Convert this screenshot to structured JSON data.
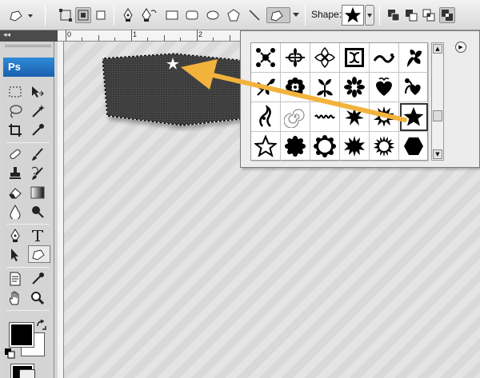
{
  "options_bar": {
    "shape_label": "Shape:",
    "selected_shape": "star-icon",
    "tools": [
      "shape-layers-mode-icon",
      "paths-mode-icon",
      "fill-pixels-mode-icon",
      "pen-icon",
      "freeform-pen-icon",
      "rectangle-icon",
      "rounded-rectangle-icon",
      "ellipse-icon",
      "polygon-icon",
      "line-icon",
      "custom-shape-icon"
    ],
    "combine_modes": [
      "add-to-shape-area-icon",
      "subtract-from-shape-area-icon",
      "intersect-shape-areas-icon",
      "exclude-overlapping-areas-icon"
    ]
  },
  "tool_panel": {
    "logo": "Ps",
    "foreground_color": "#000000",
    "background_color": "#ffffff",
    "tools": [
      "rectangular-marquee-icon",
      "move-icon",
      "lasso-icon",
      "magic-wand-icon",
      "crop-icon",
      "eyedropper-icon",
      "spot-healing-icon",
      "brush-icon",
      "clone-stamp-icon",
      "history-brush-icon",
      "eraser-icon",
      "gradient-icon",
      "blur-icon",
      "dodge-icon",
      "pen-icon",
      "type-icon",
      "path-selection-icon",
      "custom-shape-icon",
      "notes-icon",
      "eyedropper-icon",
      "hand-icon",
      "zoom-icon"
    ]
  },
  "rulers": {
    "top_labels": [
      "0",
      "1",
      "2"
    ]
  },
  "shape_picker": {
    "shapes": [
      "ornament-1",
      "fleur-1",
      "ornament-2",
      "tile-ornament",
      "scroll-ornament",
      "flower-ornament",
      "leaf-ornament",
      "flower",
      "floral-1",
      "floral-2",
      "heart-ornament",
      "leaf-heart",
      "ornament-3",
      "spiral",
      "wave-line",
      "starburst",
      "sun-burst",
      "star",
      "star-outline",
      "blob-circle",
      "circle-frame",
      "sun-seal",
      "sun",
      "hexagon"
    ],
    "selected_shape": "star"
  },
  "colors": {
    "accent_arrow": "#f2b33d",
    "selection_fill": "#4a4a4a"
  }
}
